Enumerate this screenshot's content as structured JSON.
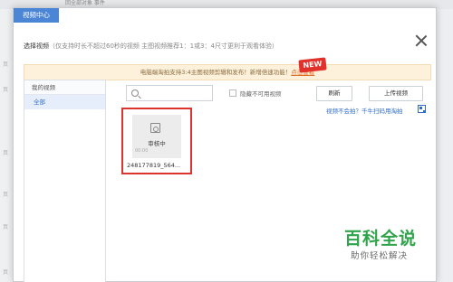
{
  "background": {
    "top_text": "回全部对象      事件",
    "side_marks": [
      "页",
      "页",
      "页",
      "页",
      "页",
      "页"
    ]
  },
  "dialog": {
    "tab_label": "视频中心",
    "header_title": "选择视频",
    "header_hint": "（仅支持时长不超过60秒的视频 主图视频推荐1：1或3：4尺寸更利于观看体验）",
    "notice_text": "电脑端淘拍支持3:4主图视频剪辑和发布！新增倍速功能！",
    "notice_link": "点击查看",
    "new_badge": "NEW"
  },
  "sidebar": {
    "title": "我的视频",
    "items": [
      {
        "label": "全部"
      }
    ]
  },
  "toolbar": {
    "search_placeholder": "",
    "checkbox_label": "隐藏不可用视频",
    "refresh_label": "刷新",
    "upload_label": "上传视频",
    "help_link": "视频不会拍？千牛扫码用淘拍"
  },
  "videos": [
    {
      "status": "审核中",
      "duration": "00:00",
      "filename": "248177819_564..."
    }
  ],
  "watermark": {
    "title": "百科全说",
    "subtitle": "助你轻松解决"
  },
  "colors": {
    "accent": "#4b86d6",
    "link": "#2f6cc9",
    "highlight_border": "#d9352e",
    "badge": "#e2302a",
    "watermark": "#2fa44a"
  }
}
